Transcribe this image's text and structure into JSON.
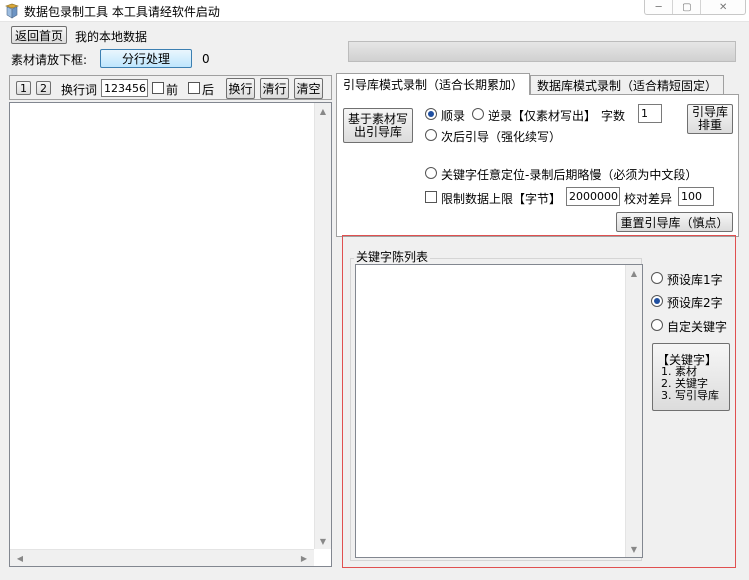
{
  "window": {
    "title": "数据包录制工具  本工具请经软件启动",
    "minimize_glyph": "─",
    "maximize_glyph": "▢",
    "close_glyph": "✕"
  },
  "top": {
    "back_home": "返回首页",
    "my_data": "我的本地数据",
    "material_label": "素材请放下框:",
    "split_button": "分行处理",
    "count": "0"
  },
  "left_toolbar": {
    "btn1": "1",
    "btn2": "2",
    "newline_label": "换行词",
    "newline_value": "123456",
    "front_label": "前",
    "back_label": "后",
    "newline_btn": "换行",
    "clear_line_btn": "清行",
    "clear_all_btn": "清空"
  },
  "tabs": [
    {
      "label": "引导库模式录制（适合长期累加）"
    },
    {
      "label": "数据库模式录制（适合精短固定）"
    }
  ],
  "tab_content": {
    "material_write_btn_l1": "基于素材写",
    "material_write_btn_l2": "出引导库",
    "seq_label": "顺录",
    "reverse_label": "逆录【仅素材写出】",
    "chars_label": "字数",
    "chars_value": "1",
    "next_guide_label": "次后引导（强化续写）",
    "sort_btn_l1": "引导库",
    "sort_btn_l2": "排重",
    "keyword_pos_label": "关键字任意定位-录制后期略慢（必须为中文段）",
    "limit_label": "限制数据上限【字节】",
    "limit_value": "2000000",
    "diff_label": "校对差异",
    "diff_value": "100",
    "reset_btn": "重置引导库（慎点）"
  },
  "keywords": {
    "group_title": "关键字陈列表",
    "preset1": "预设库1字",
    "preset2": "预设库2字",
    "custom": "自定关键字",
    "info_title": "【关键字】",
    "info_1": "1. 素材",
    "info_2": "2. 关键字",
    "info_3": "3. 写引导库"
  },
  "scroll_glyphs": {
    "up": "▲",
    "down": "▼",
    "left": "◀",
    "right": "▶"
  }
}
